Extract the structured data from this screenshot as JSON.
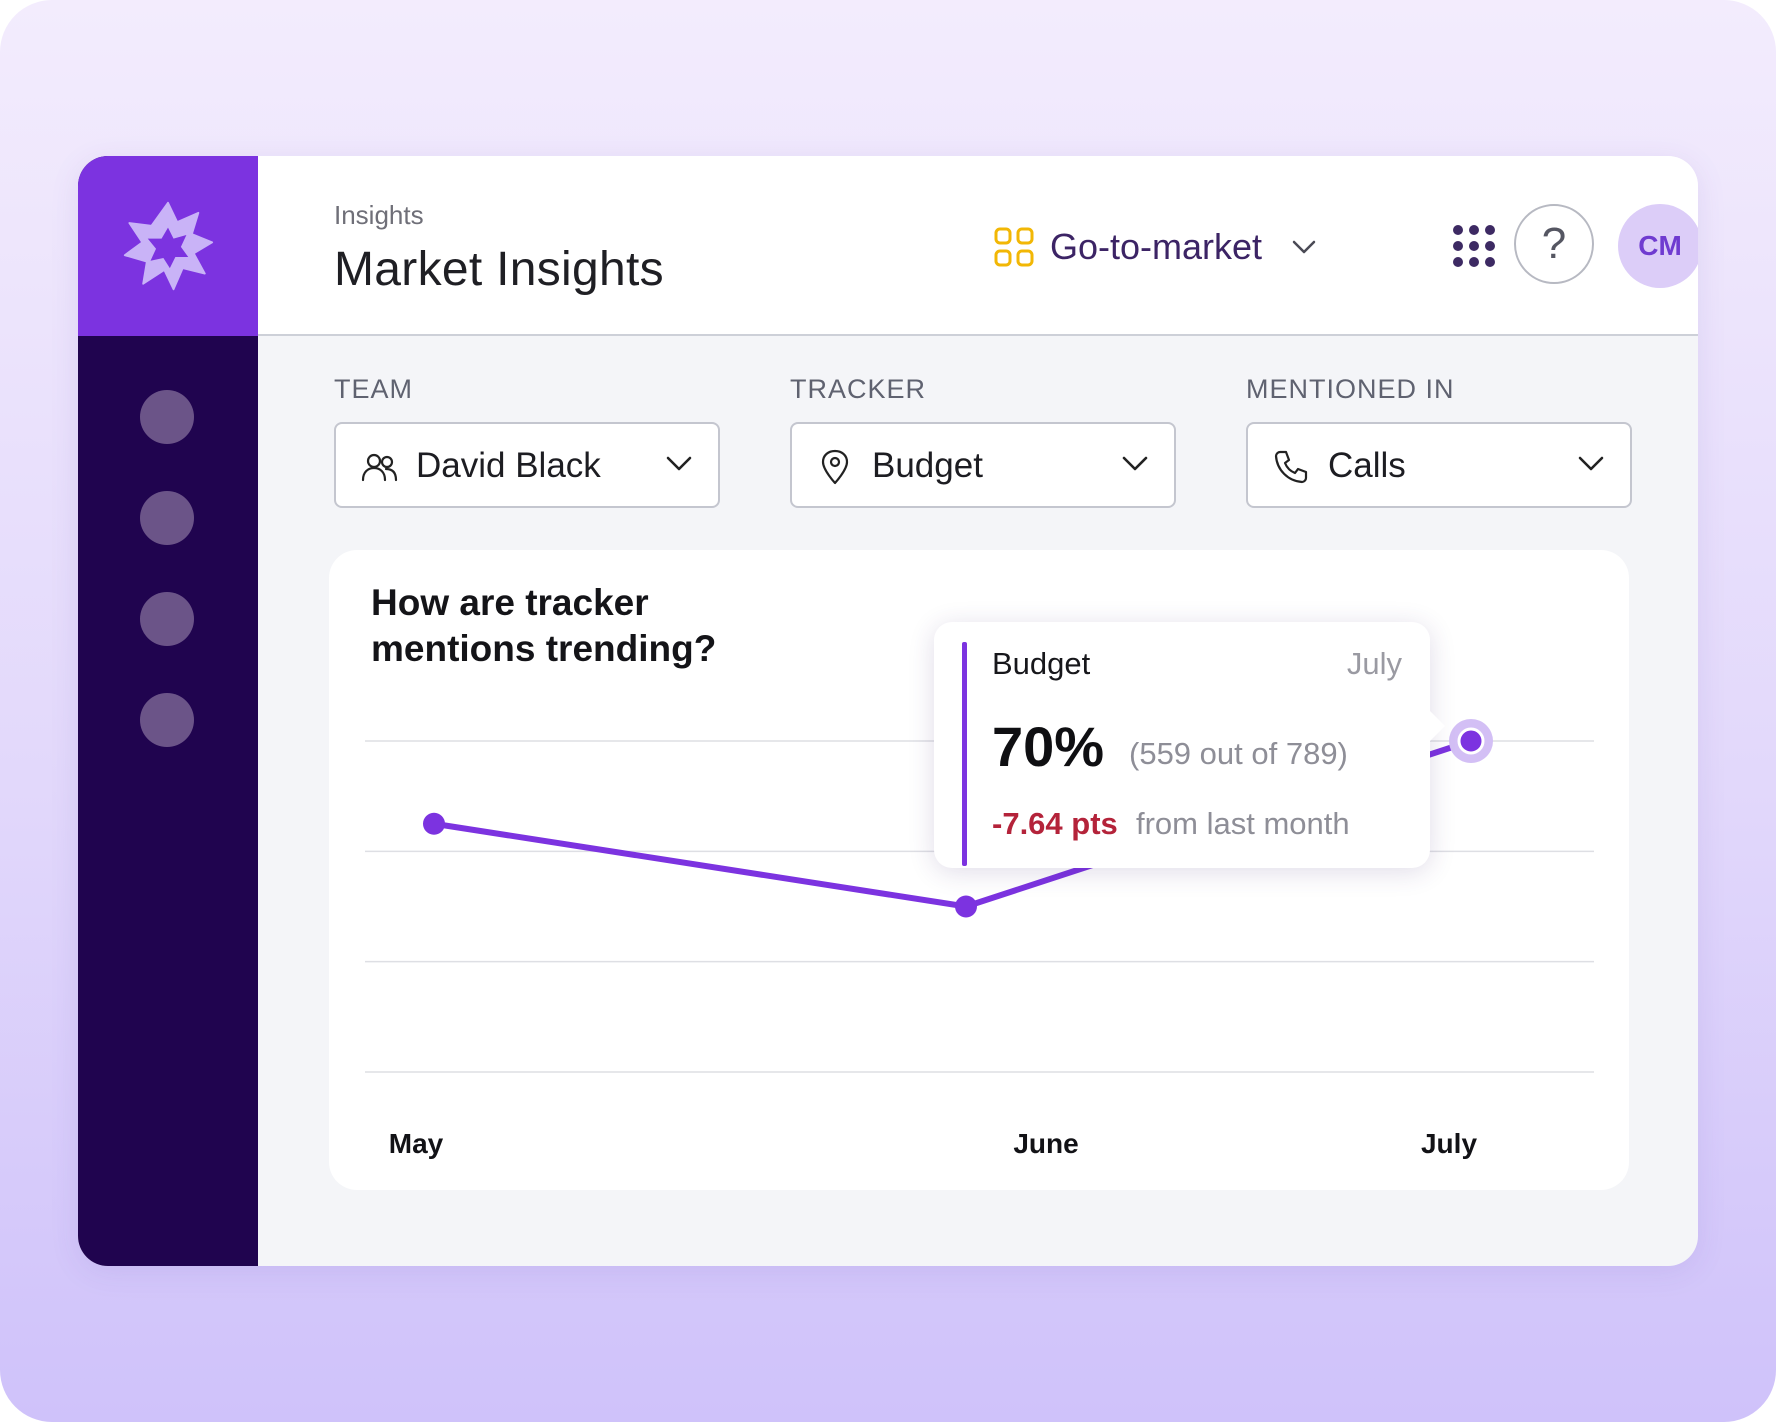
{
  "header": {
    "breadcrumb": "Insights",
    "title": "Market Insights",
    "workspace": "Go-to-market",
    "help_label": "?",
    "avatar_initials": "CM"
  },
  "filters": [
    {
      "label": "TEAM",
      "value": "David Black",
      "icon": "users-icon"
    },
    {
      "label": "TRACKER",
      "value": "Budget",
      "icon": "map-pin-icon"
    },
    {
      "label": "MENTIONED IN",
      "value": "Calls",
      "icon": "phone-icon"
    }
  ],
  "colors": {
    "accent": "#7c33e0",
    "sidebar": "#20044f",
    "negative": "#b4233a"
  },
  "chart": {
    "title": "How are tracker mentions trending?",
    "tooltip": {
      "series": "Budget",
      "month": "July",
      "percent": "70%",
      "count": "(559 out of 789)",
      "delta": "-7.64 pts",
      "delta_text": "from last month"
    }
  },
  "chart_data": {
    "type": "line",
    "categories": [
      "May",
      "June",
      "July"
    ],
    "series": [
      {
        "name": "Budget",
        "values": [
          55,
          40,
          70
        ]
      }
    ],
    "ylim": [
      10,
      70
    ],
    "grid": true,
    "highlighted_point": "July"
  }
}
